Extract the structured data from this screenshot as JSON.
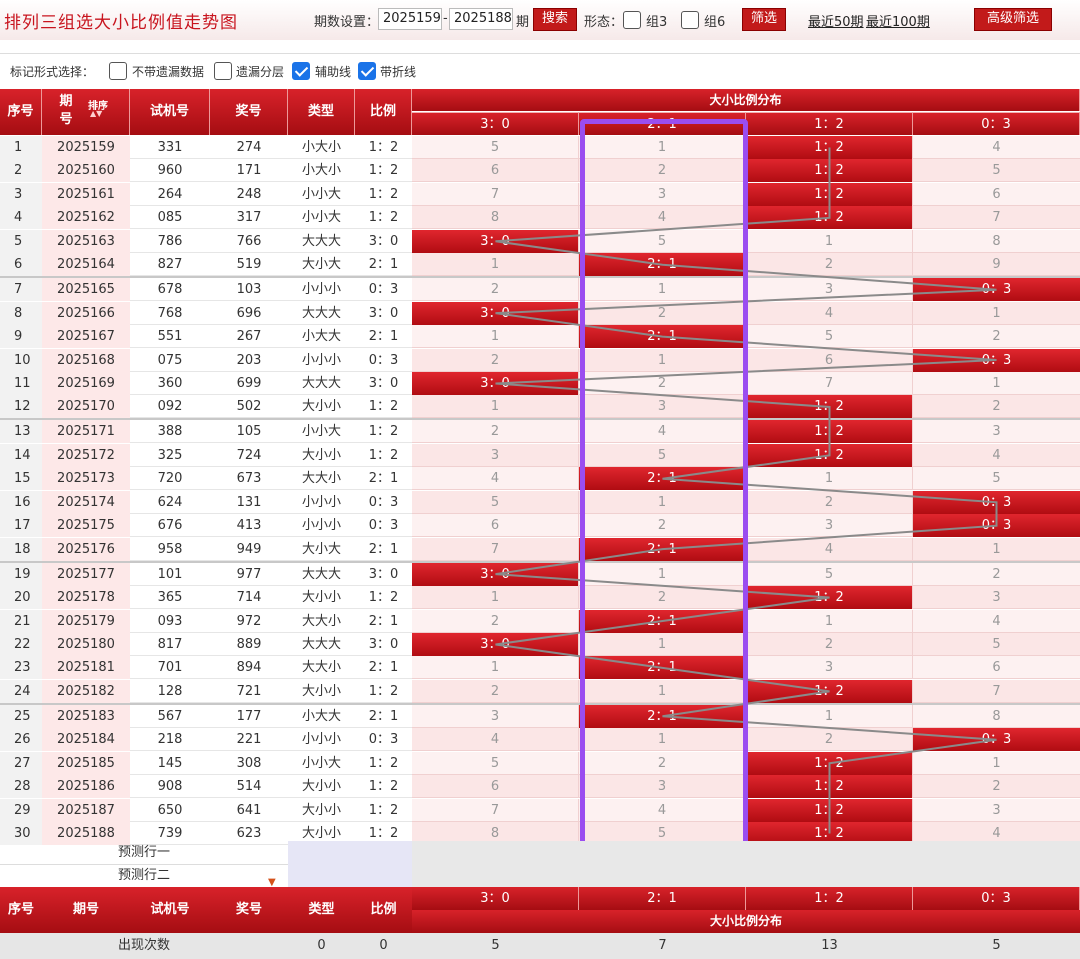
{
  "title": "排列三组选大小比例值走势图",
  "toolbar": {
    "period_label": "期数设置：",
    "from": "2025159",
    "dash": "-",
    "to": "2025188",
    "qi": "期",
    "search": "搜索",
    "form_label": "形态：",
    "z3": "组3",
    "z6": "组6",
    "filter": "筛选",
    "recent50": "最近50期",
    "recent100": "最近100期",
    "advanced": "高级筛选"
  },
  "mark": {
    "label": "标记形式选择：",
    "opt1": "不带遗漏数据",
    "opt2": "遗漏分层",
    "opt3": "辅助线",
    "opt4": "带折线",
    "checked": [
      false,
      false,
      true,
      true
    ]
  },
  "headers": {
    "seq": "序号",
    "period": "期号",
    "sort": "排序",
    "sort_arrows": "▲▼",
    "test": "试机号",
    "prize": "奖号",
    "type": "类型",
    "ratio": "比例",
    "dist": "大小比例分布",
    "cats": [
      "3：0",
      "2：1",
      "1：2",
      "0：3"
    ]
  },
  "rows": [
    {
      "n": "1",
      "p": "2025159",
      "t": "331",
      "z": "274",
      "ty": "小大小",
      "r": "1：2",
      "c": [
        5,
        1,
        "1：2",
        4
      ]
    },
    {
      "n": "2",
      "p": "2025160",
      "t": "960",
      "z": "171",
      "ty": "小大小",
      "r": "1：2",
      "c": [
        6,
        2,
        "1：2",
        5
      ]
    },
    {
      "n": "3",
      "p": "2025161",
      "t": "264",
      "z": "248",
      "ty": "小小大",
      "r": "1：2",
      "c": [
        7,
        3,
        "1：2",
        6
      ]
    },
    {
      "n": "4",
      "p": "2025162",
      "t": "085",
      "z": "317",
      "ty": "小小大",
      "r": "1：2",
      "c": [
        8,
        4,
        "1：2",
        7
      ]
    },
    {
      "n": "5",
      "p": "2025163",
      "t": "786",
      "z": "766",
      "ty": "大大大",
      "r": "3：0",
      "c": [
        "3：0",
        5,
        1,
        8
      ]
    },
    {
      "n": "6",
      "p": "2025164",
      "t": "827",
      "z": "519",
      "ty": "大小大",
      "r": "2：1",
      "c": [
        1,
        "2：1",
        2,
        9
      ]
    },
    {
      "n": "7",
      "p": "2025165",
      "t": "678",
      "z": "103",
      "ty": "小小小",
      "r": "0：3",
      "c": [
        2,
        1,
        3,
        "0：3"
      ]
    },
    {
      "n": "8",
      "p": "2025166",
      "t": "768",
      "z": "696",
      "ty": "大大大",
      "r": "3：0",
      "c": [
        "3：0",
        2,
        4,
        1
      ]
    },
    {
      "n": "9",
      "p": "2025167",
      "t": "551",
      "z": "267",
      "ty": "小大大",
      "r": "2：1",
      "c": [
        1,
        "2：1",
        5,
        2
      ]
    },
    {
      "n": "10",
      "p": "2025168",
      "t": "075",
      "z": "203",
      "ty": "小小小",
      "r": "0：3",
      "c": [
        2,
        1,
        6,
        "0：3"
      ]
    },
    {
      "n": "11",
      "p": "2025169",
      "t": "360",
      "z": "699",
      "ty": "大大大",
      "r": "3：0",
      "c": [
        "3：0",
        2,
        7,
        1
      ]
    },
    {
      "n": "12",
      "p": "2025170",
      "t": "092",
      "z": "502",
      "ty": "大小小",
      "r": "1：2",
      "c": [
        1,
        3,
        "1：2",
        2
      ]
    },
    {
      "n": "13",
      "p": "2025171",
      "t": "388",
      "z": "105",
      "ty": "小小大",
      "r": "1：2",
      "c": [
        2,
        4,
        "1：2",
        3
      ]
    },
    {
      "n": "14",
      "p": "2025172",
      "t": "325",
      "z": "724",
      "ty": "大小小",
      "r": "1：2",
      "c": [
        3,
        5,
        "1：2",
        4
      ]
    },
    {
      "n": "15",
      "p": "2025173",
      "t": "720",
      "z": "673",
      "ty": "大大小",
      "r": "2：1",
      "c": [
        4,
        "2：1",
        1,
        5
      ]
    },
    {
      "n": "16",
      "p": "2025174",
      "t": "624",
      "z": "131",
      "ty": "小小小",
      "r": "0：3",
      "c": [
        5,
        1,
        2,
        "0：3"
      ]
    },
    {
      "n": "17",
      "p": "2025175",
      "t": "676",
      "z": "413",
      "ty": "小小小",
      "r": "0：3",
      "c": [
        6,
        2,
        3,
        "0：3"
      ]
    },
    {
      "n": "18",
      "p": "2025176",
      "t": "958",
      "z": "949",
      "ty": "大小大",
      "r": "2：1",
      "c": [
        7,
        "2：1",
        4,
        1
      ]
    },
    {
      "n": "19",
      "p": "2025177",
      "t": "101",
      "z": "977",
      "ty": "大大大",
      "r": "3：0",
      "c": [
        "3：0",
        1,
        5,
        2
      ]
    },
    {
      "n": "20",
      "p": "2025178",
      "t": "365",
      "z": "714",
      "ty": "大小小",
      "r": "1：2",
      "c": [
        1,
        2,
        "1：2",
        3
      ]
    },
    {
      "n": "21",
      "p": "2025179",
      "t": "093",
      "z": "972",
      "ty": "大大小",
      "r": "2：1",
      "c": [
        2,
        "2：1",
        1,
        4
      ]
    },
    {
      "n": "22",
      "p": "2025180",
      "t": "817",
      "z": "889",
      "ty": "大大大",
      "r": "3：0",
      "c": [
        "3：0",
        1,
        2,
        5
      ]
    },
    {
      "n": "23",
      "p": "2025181",
      "t": "701",
      "z": "894",
      "ty": "大大小",
      "r": "2：1",
      "c": [
        1,
        "2：1",
        3,
        6
      ]
    },
    {
      "n": "24",
      "p": "2025182",
      "t": "128",
      "z": "721",
      "ty": "大小小",
      "r": "1：2",
      "c": [
        2,
        1,
        "1：2",
        7
      ]
    },
    {
      "n": "25",
      "p": "2025183",
      "t": "567",
      "z": "177",
      "ty": "小大大",
      "r": "2：1",
      "c": [
        3,
        "2：1",
        1,
        8
      ]
    },
    {
      "n": "26",
      "p": "2025184",
      "t": "218",
      "z": "221",
      "ty": "小小小",
      "r": "0：3",
      "c": [
        4,
        1,
        2,
        "0：3"
      ]
    },
    {
      "n": "27",
      "p": "2025185",
      "t": "145",
      "z": "308",
      "ty": "小小大",
      "r": "1：2",
      "c": [
        5,
        2,
        "1：2",
        1
      ]
    },
    {
      "n": "28",
      "p": "2025186",
      "t": "908",
      "z": "514",
      "ty": "大小小",
      "r": "1：2",
      "c": [
        6,
        3,
        "1：2",
        2
      ]
    },
    {
      "n": "29",
      "p": "2025187",
      "t": "650",
      "z": "641",
      "ty": "大小小",
      "r": "1：2",
      "c": [
        7,
        4,
        "1：2",
        3
      ]
    },
    {
      "n": "30",
      "p": "2025188",
      "t": "739",
      "z": "623",
      "ty": "大小小",
      "r": "1：2",
      "c": [
        8,
        5,
        "1：2",
        4
      ]
    }
  ],
  "predict": [
    "预测行一",
    "预测行二"
  ],
  "stats": {
    "label": "出现次数",
    "type": "0",
    "ratio": "0",
    "counts": [
      "5",
      "7",
      "13",
      "5"
    ]
  },
  "colors": {
    "accent": "#c8141e",
    "row_alt": "#fbeaea",
    "highlight": "#9a4df0"
  }
}
